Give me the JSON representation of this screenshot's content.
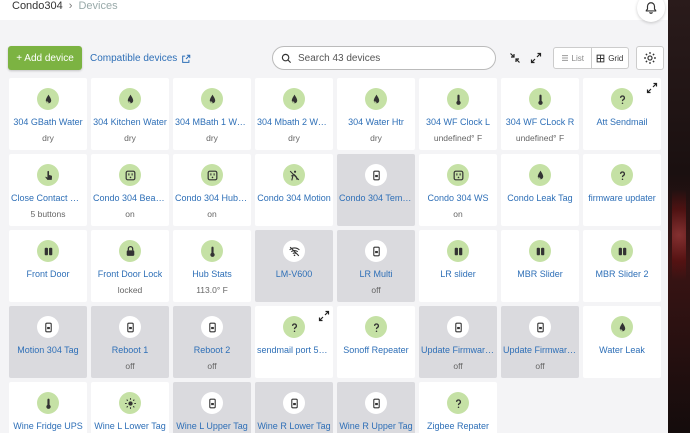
{
  "breadcrumb": {
    "hub": "Condo304",
    "page": "Devices"
  },
  "toolbar": {
    "add_label": "+ Add device",
    "compat_label": "Compatible devices",
    "search_placeholder": "Search 43 devices",
    "list_label": "List",
    "grid_label": "Grid"
  },
  "colors": {
    "accent": "#7cb342",
    "link": "#2e6fb7",
    "icon_bg": "#c5e1a5",
    "tile_off": "#dadade"
  },
  "devices": [
    {
      "name": "304 GBath Water",
      "state": "dry",
      "icon": "water-drop-icon",
      "off": false
    },
    {
      "name": "304 Kitchen Water",
      "state": "dry",
      "icon": "water-drop-icon",
      "off": false
    },
    {
      "name": "304 MBath 1 Wat…",
      "state": "dry",
      "icon": "water-drop-icon",
      "off": false
    },
    {
      "name": "304 Mbath 2 Wat…",
      "state": "dry",
      "icon": "water-drop-icon",
      "off": false
    },
    {
      "name": "304 Water Htr",
      "state": "dry",
      "icon": "water-drop-icon",
      "off": false
    },
    {
      "name": "304 WF Clock L",
      "state": "undefined° F",
      "icon": "thermometer-icon",
      "off": false
    },
    {
      "name": "304 WF CLock R",
      "state": "undefined° F",
      "icon": "thermometer-icon",
      "off": false
    },
    {
      "name": "Att Sendmail",
      "state": "",
      "icon": "question-icon",
      "off": false,
      "expand": true
    },
    {
      "name": "Close Contact Bu…",
      "state": "5 buttons",
      "icon": "touch-icon",
      "off": false
    },
    {
      "name": "Condo 304 Beac…",
      "state": "on",
      "icon": "outlet-icon",
      "off": false
    },
    {
      "name": "Condo 304 Hubitat",
      "state": "on",
      "icon": "outlet-icon",
      "off": false
    },
    {
      "name": "Condo 304 Motion",
      "state": "",
      "icon": "motion-off-icon",
      "off": false
    },
    {
      "name": "Condo 304 Temp…",
      "state": "",
      "icon": "sensor-icon",
      "off": true
    },
    {
      "name": "Condo 304 WS",
      "state": "on",
      "icon": "outlet-icon",
      "off": false
    },
    {
      "name": "Condo Leak Tag",
      "state": "",
      "icon": "water-drop-icon",
      "off": false
    },
    {
      "name": "firmware updater",
      "state": "",
      "icon": "question-icon",
      "off": false
    },
    {
      "name": "Front Door",
      "state": "",
      "icon": "contact-icon",
      "off": false
    },
    {
      "name": "Front Door Lock",
      "state": "locked",
      "icon": "lock-icon",
      "off": false
    },
    {
      "name": "Hub Stats",
      "state": "113.0° F",
      "icon": "thermometer-icon",
      "off": false
    },
    {
      "name": "LM-V600",
      "state": "",
      "icon": "wifi-off-icon",
      "off": true
    },
    {
      "name": "LR Multi",
      "state": "off",
      "icon": "sensor-icon",
      "off": true
    },
    {
      "name": "LR slider",
      "state": "",
      "icon": "contact-icon",
      "off": false
    },
    {
      "name": "MBR Slider",
      "state": "",
      "icon": "contact-icon",
      "off": false
    },
    {
      "name": "MBR Slider 2",
      "state": "",
      "icon": "contact-icon",
      "off": false
    },
    {
      "name": "Motion 304 Tag",
      "state": "",
      "icon": "sensor-icon",
      "off": true
    },
    {
      "name": "Reboot 1",
      "state": "off",
      "icon": "sensor-icon",
      "off": true
    },
    {
      "name": "Reboot 2",
      "state": "off",
      "icon": "sensor-icon",
      "off": true
    },
    {
      "name": "sendmail port 58…",
      "state": "",
      "icon": "question-icon",
      "off": false,
      "expand": true
    },
    {
      "name": "Sonoff Repeater",
      "state": "",
      "icon": "question-icon",
      "off": false
    },
    {
      "name": "Update Firmware…",
      "state": "off",
      "icon": "sensor-icon",
      "off": true
    },
    {
      "name": "Update Firmware…",
      "state": "off",
      "icon": "sensor-icon",
      "off": true
    },
    {
      "name": "Water Leak",
      "state": "",
      "icon": "water-drop-icon",
      "off": false
    },
    {
      "name": "Wine Fridge UPS",
      "state": "",
      "icon": "thermometer-icon",
      "off": false
    },
    {
      "name": "Wine L Lower Tag",
      "state": "",
      "icon": "sun-icon",
      "off": false
    },
    {
      "name": "Wine L Upper Tag",
      "state": "",
      "icon": "sensor-icon",
      "off": true
    },
    {
      "name": "Wine R Lower Tag",
      "state": "",
      "icon": "sensor-icon",
      "off": true
    },
    {
      "name": "Wine R Upper Tag",
      "state": "",
      "icon": "sensor-icon",
      "off": true
    },
    {
      "name": "Zigbee Repater",
      "state": "",
      "icon": "question-icon",
      "off": false
    }
  ]
}
